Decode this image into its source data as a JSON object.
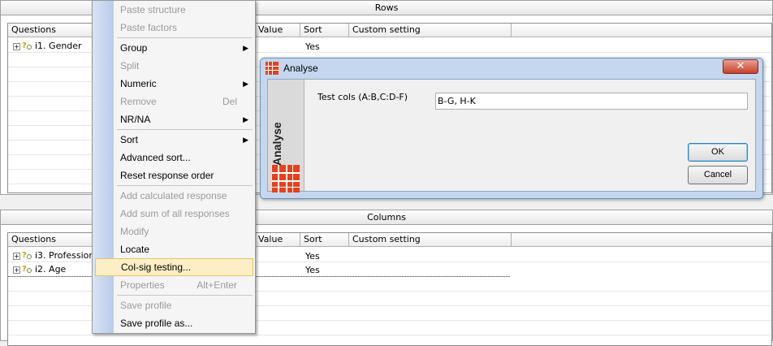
{
  "rows_panel": {
    "title": "Rows",
    "headers": {
      "questions": "Questions",
      "value": "Value",
      "sort": "Sort",
      "custom": "Custom setting"
    },
    "items": [
      {
        "label": "i1. Gender",
        "sort": "Yes"
      }
    ]
  },
  "columns_panel": {
    "title": "Columns",
    "headers": {
      "questions": "Questions",
      "value": "Value",
      "sort": "Sort",
      "custom": "Custom setting"
    },
    "items": [
      {
        "label": "i3. Profession",
        "sort": "Yes"
      },
      {
        "label": "i2. Age",
        "sort": "Yes"
      }
    ]
  },
  "menu": {
    "paste_structure": "Paste structure",
    "paste_factors": "Paste factors",
    "group": "Group",
    "split": "Split",
    "numeric": "Numeric",
    "remove": "Remove",
    "remove_shortcut": "Del",
    "nrna": "NR/NA",
    "sort": "Sort",
    "advanced_sort": "Advanced sort...",
    "reset_order": "Reset response order",
    "add_calculated": "Add calculated response",
    "add_sum": "Add sum of all responses",
    "modify": "Modify",
    "locate": "Locate",
    "col_sig": "Col-sig testing...",
    "properties": "Properties",
    "properties_shortcut": "Alt+Enter",
    "save_profile": "Save profile",
    "save_profile_as": "Save profile as..."
  },
  "dialog": {
    "title": "Analyse",
    "close": "✕",
    "side_label": "Analyse",
    "field_label": "Test cols (A:B,C:D-F)",
    "field_value": "B-G, H-K",
    "ok": "OK",
    "cancel": "Cancel"
  },
  "colors": {
    "highlight": "#fcefc6",
    "dialog_frame": "#c4d7ee",
    "logo_red": "#e8401c"
  }
}
